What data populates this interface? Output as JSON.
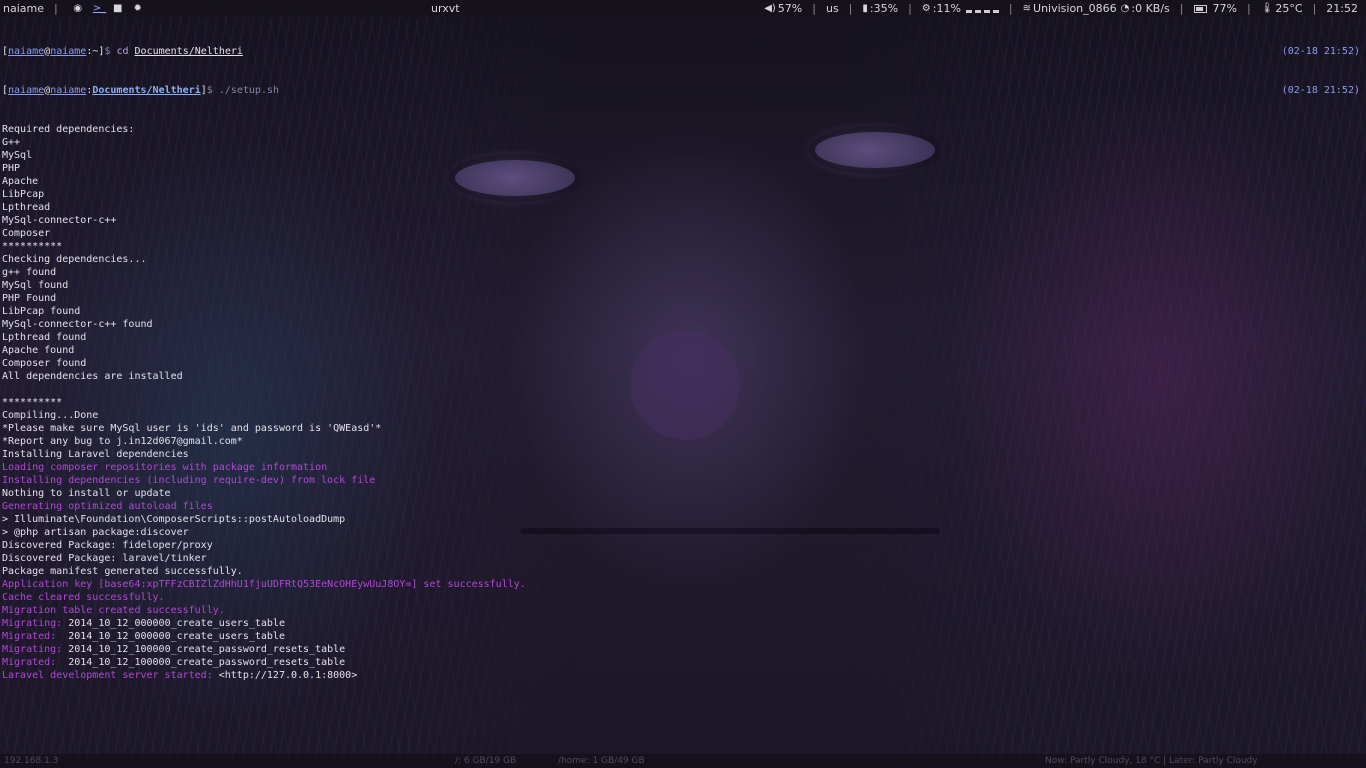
{
  "topbar": {
    "username": "naiame",
    "window_title": "urxvt",
    "volume": "57%",
    "keyboard_layout": "us",
    "memory": ":35%",
    "cpu": ":11%",
    "wifi_ssid": "Univision_0866",
    "net_speed": ":0 KB/s",
    "battery": "77%",
    "temperature": "25°C",
    "clock": "21:52"
  },
  "terminal": {
    "prompt1": {
      "user": "naiame",
      "host": "naiame",
      "cwd": "~",
      "command_name": "cd",
      "command_arg": "Documents/Neltheri",
      "timestamp": "(02-18 21:52)"
    },
    "prompt2": {
      "user": "naiame",
      "host": "naiame",
      "cwd": "Documents/Neltheri",
      "command": "./setup.sh",
      "timestamp": "(02-18 21:52)"
    },
    "output": [
      {
        "text": "Required dependencies:",
        "color": "white"
      },
      {
        "text": "G++",
        "color": "white"
      },
      {
        "text": "MySql",
        "color": "white"
      },
      {
        "text": "PHP",
        "color": "white"
      },
      {
        "text": "Apache",
        "color": "white"
      },
      {
        "text": "LibPcap",
        "color": "white"
      },
      {
        "text": "Lpthread",
        "color": "white"
      },
      {
        "text": "MySql-connector-c++",
        "color": "white"
      },
      {
        "text": "Composer",
        "color": "white"
      },
      {
        "text": "**********",
        "color": "white"
      },
      {
        "text": "Checking dependencies...",
        "color": "white"
      },
      {
        "text": "g++ found",
        "color": "white"
      },
      {
        "text": "MySql found",
        "color": "white"
      },
      {
        "text": "PHP Found",
        "color": "white"
      },
      {
        "text": "LibPcap found",
        "color": "white"
      },
      {
        "text": "MySql-connector-c++ found",
        "color": "white"
      },
      {
        "text": "Lpthread found",
        "color": "white"
      },
      {
        "text": "Apache found",
        "color": "white"
      },
      {
        "text": "Composer found",
        "color": "white"
      },
      {
        "text": "All dependencies are installed",
        "color": "white"
      },
      {
        "text": "",
        "color": "white"
      },
      {
        "text": "**********",
        "color": "white"
      },
      {
        "text": "Compiling...Done",
        "color": "white"
      },
      {
        "text": "*Please make sure MySql user is 'ids' and password is 'QWEasd'*",
        "color": "white"
      },
      {
        "text": "*Report any bug to j.in12d067@gmail.com*",
        "color": "white"
      },
      {
        "text": "Installing Laravel dependencies",
        "color": "white"
      },
      {
        "text": "Loading composer repositories with package information",
        "color": "purple"
      },
      {
        "text": "Installing dependencies (including require-dev) from lock file",
        "color": "purple"
      },
      {
        "text": "Nothing to install or update",
        "color": "white"
      },
      {
        "text": "Generating optimized autoload files",
        "color": "purple"
      },
      {
        "text": "> Illuminate\\Foundation\\ComposerScripts::postAutoloadDump",
        "color": "white"
      },
      {
        "text": "> @php artisan package:discover",
        "color": "white"
      },
      {
        "text": "Discovered Package: fideloper/proxy",
        "color": "white"
      },
      {
        "text": "Discovered Package: laravel/tinker",
        "color": "white"
      },
      {
        "text": "Package manifest generated successfully.",
        "color": "white"
      },
      {
        "text": "Application key [base64:xpTFFzCBIZlZdHhU1fjuUDFRtQ53EeNcOHEywUuJ8OY=] set successfully.",
        "color": "purple"
      },
      {
        "text": "Cache cleared successfully.",
        "color": "purple"
      },
      {
        "text": "Migration table created successfully.",
        "color": "purple"
      },
      {
        "prefix": "Migrating: ",
        "text": "2014_10_12_000000_create_users_table",
        "color": "mixed"
      },
      {
        "prefix": "Migrated:  ",
        "text": "2014_10_12_000000_create_users_table",
        "color": "mixed"
      },
      {
        "prefix": "Migrating: ",
        "text": "2014_10_12_100000_create_password_resets_table",
        "color": "mixed"
      },
      {
        "prefix": "Migrated:  ",
        "text": "2014_10_12_100000_create_password_resets_table",
        "color": "mixed"
      },
      {
        "prefix": "Laravel development server started: ",
        "text": "<http://127.0.0.1:8000>",
        "color": "mixed"
      }
    ]
  },
  "bottombar": {
    "ip": "192.168.1.3",
    "disk1": "/: 6 GB/19 GB",
    "disk2": "/home: 1 GB/49 GB",
    "weather": "Now: Partly Cloudy, 18 °C | Later: Partly Cloudy"
  },
  "colors": {
    "purple": "#b247d6",
    "white": "#e4e0ea",
    "prompt_user": "#8a9cf0",
    "prompt_path": "#8ab0f5"
  }
}
